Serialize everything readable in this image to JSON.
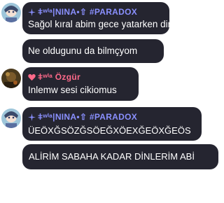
{
  "colors": {
    "bubble_bg": "#252530",
    "nina_name": "#8a90ff",
    "ozgur_name": "#ff6a8a",
    "message_text": "#ffffff",
    "page_bg": "#ffffff"
  },
  "messages": [
    {
      "sender": "ǂʷⁱᵃ|NINA•⇧ #PARADOX",
      "text": "Sağol kıral abim gece yatarken dinlicem",
      "avatar_icon": "anime-avatar-icon"
    },
    {
      "text": "Ne oldugunu da bilmçyom"
    },
    {
      "sender": "ǂʷⁱᵃ Özgür",
      "text": "Inlemw sesi cikiomus",
      "avatar_icon": "photo-avatar-icon"
    },
    {
      "sender": "ǂʷⁱᵃ|NINA•⇧ #PARADOX",
      "text": "ÜEÖXĞSÖZĞSÖEĞXÖEXĞEÖXĞEÖS",
      "avatar_icon": "anime-avatar-icon"
    },
    {
      "text": "ALİRİM SABAHA KADAR DİNLERİM ABİ"
    }
  ]
}
